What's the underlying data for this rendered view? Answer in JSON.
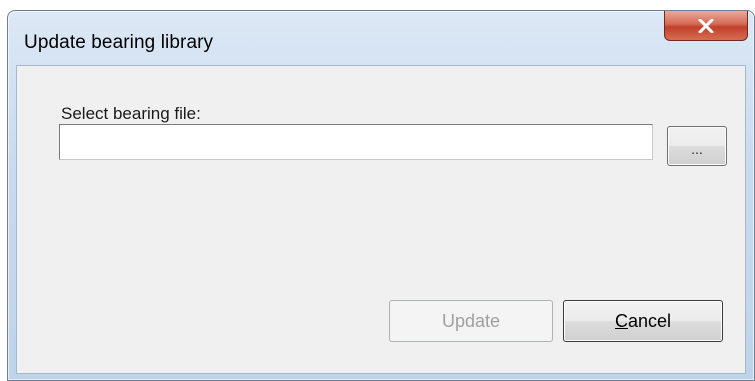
{
  "window": {
    "title": "Update bearing library"
  },
  "form": {
    "file_label": "Select bearing file:",
    "file_value": "",
    "browse_label": "..."
  },
  "buttons": {
    "update_label": "Update",
    "update_enabled": false,
    "cancel_label_mnemonic": "C",
    "cancel_label_rest": "ancel"
  },
  "icons": {
    "close": "close-x-icon"
  },
  "colors": {
    "close_button": "#c9503a",
    "dialog_background": "#f0f0f0",
    "disabled_text": "#a0a0a0"
  }
}
